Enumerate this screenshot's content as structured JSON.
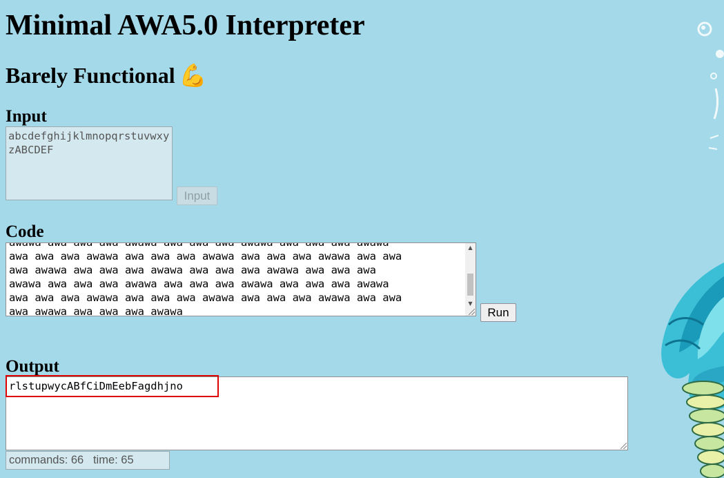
{
  "page": {
    "title": "Minimal AWA5.0 Interpreter",
    "subtitle": "Barely Functional",
    "subtitle_emoji": "💪"
  },
  "input": {
    "label": "Input",
    "value": "abcdefghijklmnopqrstuvwxyzABCDEF",
    "button_label": "Input"
  },
  "code": {
    "label": "Code",
    "value": "awawa awa awa awa awawa awa awa awa awawa awa awa awa awawa\nawa awa awa awawa awa awa awa awawa awa awa awa awawa awa awa\nawa awawa awa awa awa awawa awa awa awa awawa awa awa awa\nawawa awa awa awa awawa awa awa awa awawa awa awa awa awawa\nawa awa awa awawa awa awa awa awawa awa awa awa awawa awa awa\nawa awawa awa awa awa awawa",
    "button_label": "Run"
  },
  "output": {
    "label": "Output",
    "value": "rlstupwycABfCiDmEebFagdhjno"
  },
  "stats": {
    "text": "commands: 66   time: 65"
  },
  "colors": {
    "background": "#a3d9e8",
    "highlight": "#e00000"
  }
}
